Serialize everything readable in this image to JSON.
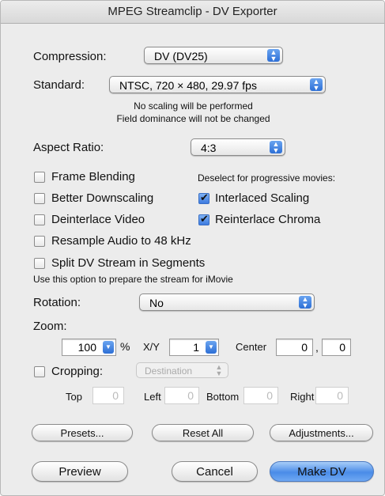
{
  "window": {
    "title": "MPEG Streamclip - DV Exporter"
  },
  "compression": {
    "label": "Compression:",
    "value": "DV (DV25)"
  },
  "standard": {
    "label": "Standard:",
    "value": "NTSC, 720 × 480, 29.97 fps"
  },
  "notes": {
    "scaling": "No scaling will be performed",
    "field": "Field dominance will not be changed"
  },
  "aspect": {
    "label": "Aspect Ratio:",
    "value": "4:3"
  },
  "options": {
    "frame_blending": {
      "label": "Frame Blending",
      "checked": false
    },
    "better_downscaling": {
      "label": "Better Downscaling",
      "checked": false
    },
    "deinterlace_video": {
      "label": "Deinterlace Video",
      "checked": false
    },
    "resample_audio": {
      "label": "Resample Audio to 48 kHz",
      "checked": false
    },
    "split_dv": {
      "label": "Split DV Stream in Segments",
      "checked": false
    },
    "split_note": "Use this option to prepare the stream for iMovie",
    "progressive_note": "Deselect for progressive movies:",
    "interlaced_scaling": {
      "label": "Interlaced Scaling",
      "checked": true
    },
    "reinterlace_chroma": {
      "label": "Reinterlace Chroma",
      "checked": true
    }
  },
  "rotation": {
    "label": "Rotation:",
    "value": "No"
  },
  "zoom": {
    "label": "Zoom:",
    "percent_value": "100",
    "percent_unit": "%",
    "xy_label": "X/Y",
    "xy_value": "1",
    "center_label": "Center",
    "center_x": "0",
    "center_sep": ",",
    "center_y": "0"
  },
  "cropping": {
    "label": "Cropping:",
    "checked": false,
    "mode": "Destination",
    "top_label": "Top",
    "top": "0",
    "left_label": "Left",
    "left": "0",
    "bottom_label": "Bottom",
    "bottom": "0",
    "right_label": "Right",
    "right": "0"
  },
  "buttons": {
    "presets": "Presets...",
    "reset_all": "Reset All",
    "adjustments": "Adjustments...",
    "preview": "Preview",
    "cancel": "Cancel",
    "make_dv": "Make DV"
  },
  "colors": {
    "accent": "#3d7be0",
    "window_bg": "#ececec"
  }
}
